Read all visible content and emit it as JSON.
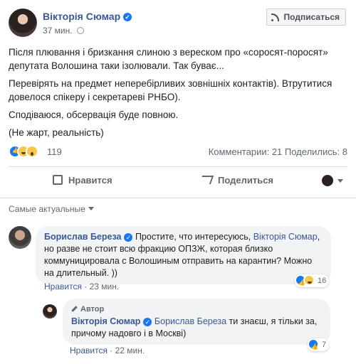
{
  "post": {
    "author": "Вікторія Сюмар",
    "time": "37 мин.",
    "subscribe_label": "Подписаться",
    "paragraphs": [
      "Після плювання і бризкання слиною з вереском про «соросят-поросят» депутата Волошина таки ізолювали. Так буває...",
      "Перевірять на предмет неперебірливих зовнішніх контактів). Втрутитися довелося спікеру і секретареві РНБО).",
      "Сподіваюся, обсервація буде повною.",
      "(Не жарт, реальність)"
    ],
    "reaction_count": "119",
    "stats": "Комментарии: 21  Поделились: 8",
    "like_label": "Нравится",
    "share_label": "Поделиться"
  },
  "comments": {
    "sort_label": "Самые актуальные",
    "c1": {
      "author": "Борислав Береза",
      "text_before": " Простите, что интересуюсь, ",
      "mention": "Вікторія Сюмар",
      "text_after": ", но разве не стоит всю фракцию ОПЗЖ, которая близко коммуницировала с Волошиным отправить на карантин? Можно на длительный. ))",
      "like_label": "Нравится",
      "time": "23 мин.",
      "reactions": "16"
    },
    "c2": {
      "author_tag": "Автор",
      "author": "Вікторія Сюмар",
      "mention": "Борислав Береза",
      "text": " ти знаєш, я тільки за, причому надовго і в Москві)",
      "like_label": "Нравится",
      "time": "22 мин.",
      "reactions": "7"
    }
  },
  "colors": {
    "link": "#385898",
    "like_blue": "#1877f2",
    "bubble_bg": "#f2f3f5"
  }
}
